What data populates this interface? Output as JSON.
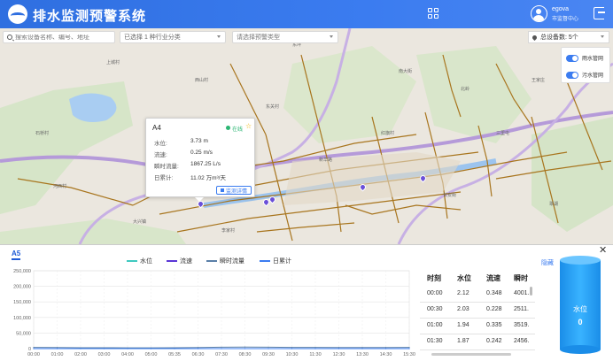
{
  "header": {
    "title": "排水监测预警系统",
    "user_name": "egova",
    "user_dept": "市监督中心"
  },
  "search": {
    "device_placeholder": "搜索设备名称、编号、地址",
    "industry_value": "已选择 1 种行业分类",
    "warning_placeholder": "请选择预警类型"
  },
  "device_count": "总设备数: 5个",
  "layers": [
    {
      "label": "雨水管网"
    },
    {
      "label": "污水管网"
    }
  ],
  "popup": {
    "title": "A4",
    "status": "在线",
    "rows": [
      {
        "label": "水位:",
        "value": "3.73 m"
      },
      {
        "label": "流速:",
        "value": "0.25 m/s"
      },
      {
        "label": "瞬时流量:",
        "value": "1867.25 L/s"
      },
      {
        "label": "日累计:",
        "value": "11.02 万m³/天"
      }
    ],
    "detail_button": "监测详情"
  },
  "map_labels": [
    "上城村",
    "西山村",
    "东坪",
    "南大街",
    "北岭",
    "石桥村",
    "河西村",
    "新华路",
    "红旗村",
    "三里屯",
    "长安街",
    "翠湖",
    "大兴镇",
    "东关村",
    "王家庄",
    "李家村"
  ],
  "panel": {
    "tag": "A5",
    "legend": [
      "水位",
      "流速",
      "瞬时流量",
      "日累计"
    ],
    "collapse": "隐藏",
    "table_headers": [
      "时刻",
      "水位",
      "流速",
      "瞬时"
    ],
    "table_rows": [
      [
        "00:00",
        "2.12",
        "0.348",
        "4001."
      ],
      [
        "00:30",
        "2.03",
        "0.228",
        "2511."
      ],
      [
        "01:00",
        "1.94",
        "0.335",
        "3519."
      ],
      [
        "01:30",
        "1.87",
        "0.242",
        "2456."
      ]
    ],
    "gauge_label": "水位",
    "gauge_value": "0"
  },
  "colors": {
    "header": "#3b7cf0",
    "water_level": "#3fc9c0",
    "velocity": "#5a37d6",
    "flow": "#5a7fa8",
    "daily": "#3b7cf0"
  },
  "chart_data": {
    "type": "line",
    "x": [
      "00:00",
      "01:00",
      "02:00",
      "03:00",
      "04:00",
      "05:00",
      "05:35",
      "06:30",
      "07:30",
      "08:30",
      "09:30",
      "10:30",
      "11:30",
      "12:30",
      "13:30",
      "14:30",
      "15:30"
    ],
    "y_ticks": [
      "0",
      "50,000",
      "100,000",
      "150,000",
      "200,000",
      "250,000"
    ],
    "ylim": [
      0,
      250000
    ],
    "series": [
      {
        "name": "水位",
        "values": [
          2,
          2,
          2,
          2,
          2,
          2,
          2,
          2,
          2,
          2,
          2,
          2,
          2,
          2,
          2,
          2,
          2
        ]
      },
      {
        "name": "流速",
        "values": [
          0.3,
          0.3,
          0.3,
          0.3,
          0.3,
          0.3,
          0.3,
          0.3,
          0.3,
          0.3,
          0.3,
          0.3,
          0.3,
          0.3,
          0.3,
          0.3,
          0.3
        ]
      },
      {
        "name": "瞬时流量",
        "values": [
          4000,
          3500,
          3000,
          2800,
          2600,
          2500,
          3000,
          3500,
          4500,
          5000,
          4500,
          4000,
          3800,
          3600,
          3500,
          3600,
          3800
        ]
      },
      {
        "name": "日累计",
        "values": [
          0,
          0,
          0,
          0,
          0,
          0,
          0,
          0,
          0,
          0,
          0,
          0,
          0,
          0,
          0,
          0,
          0
        ]
      }
    ],
    "grid": true,
    "legend_position": "top"
  }
}
